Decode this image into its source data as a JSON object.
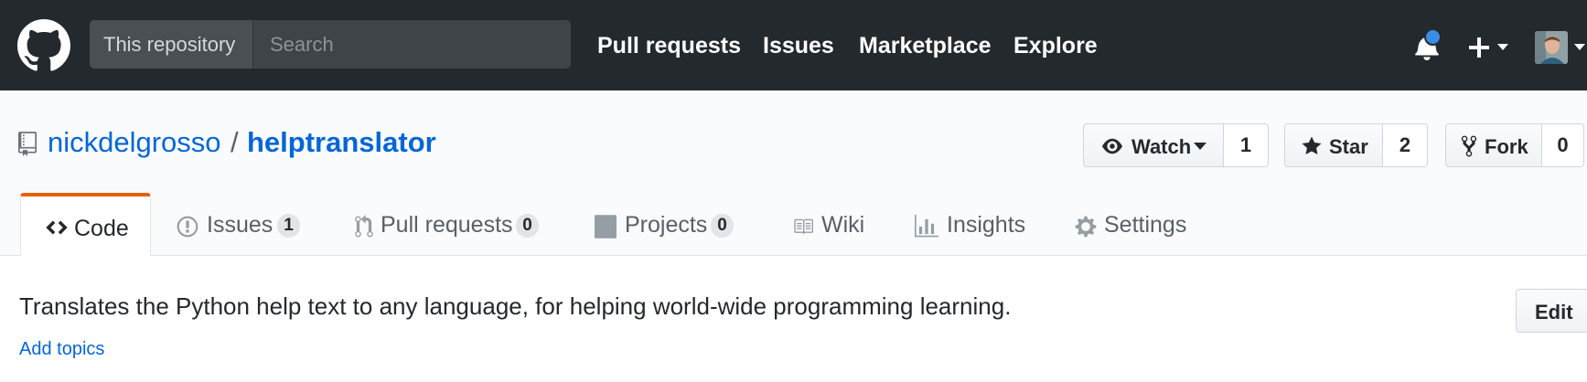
{
  "header": {
    "search_scope": "This repository",
    "search_placeholder": "Search",
    "nav": {
      "pull_requests": "Pull requests",
      "issues": "Issues",
      "marketplace": "Marketplace",
      "explore": "Explore"
    },
    "icons": [
      "github-logo-icon",
      "bell-icon",
      "plus-icon",
      "chevron-down-icon",
      "avatar"
    ],
    "notification_dot_color": "#3a8ee6"
  },
  "repo": {
    "owner": "nickdelgrosso",
    "separator": "/",
    "name": "helptranslator",
    "actions": {
      "watch_label": "Watch",
      "watch_count": "1",
      "star_label": "Star",
      "star_count": "2",
      "fork_label": "Fork",
      "fork_count": "0"
    }
  },
  "tabs": [
    {
      "label": "Code",
      "icon": "code-icon",
      "selected": true
    },
    {
      "label": "Issues",
      "icon": "issue-icon",
      "count": "1"
    },
    {
      "label": "Pull requests",
      "icon": "pull-request-icon",
      "count": "0"
    },
    {
      "label": "Projects",
      "icon": "project-icon",
      "count": "0"
    },
    {
      "label": "Wiki",
      "icon": "book-icon"
    },
    {
      "label": "Insights",
      "icon": "graph-icon"
    },
    {
      "label": "Settings",
      "icon": "gear-icon"
    }
  ],
  "about": {
    "description": "Translates the Python help text to any language, for helping world-wide programming learning.",
    "add_topics": "Add topics",
    "edit_label": "Edit"
  },
  "colors": {
    "header_bg": "#24292e",
    "link": "#0366d6",
    "selected_tab_accent": "#e36209"
  }
}
